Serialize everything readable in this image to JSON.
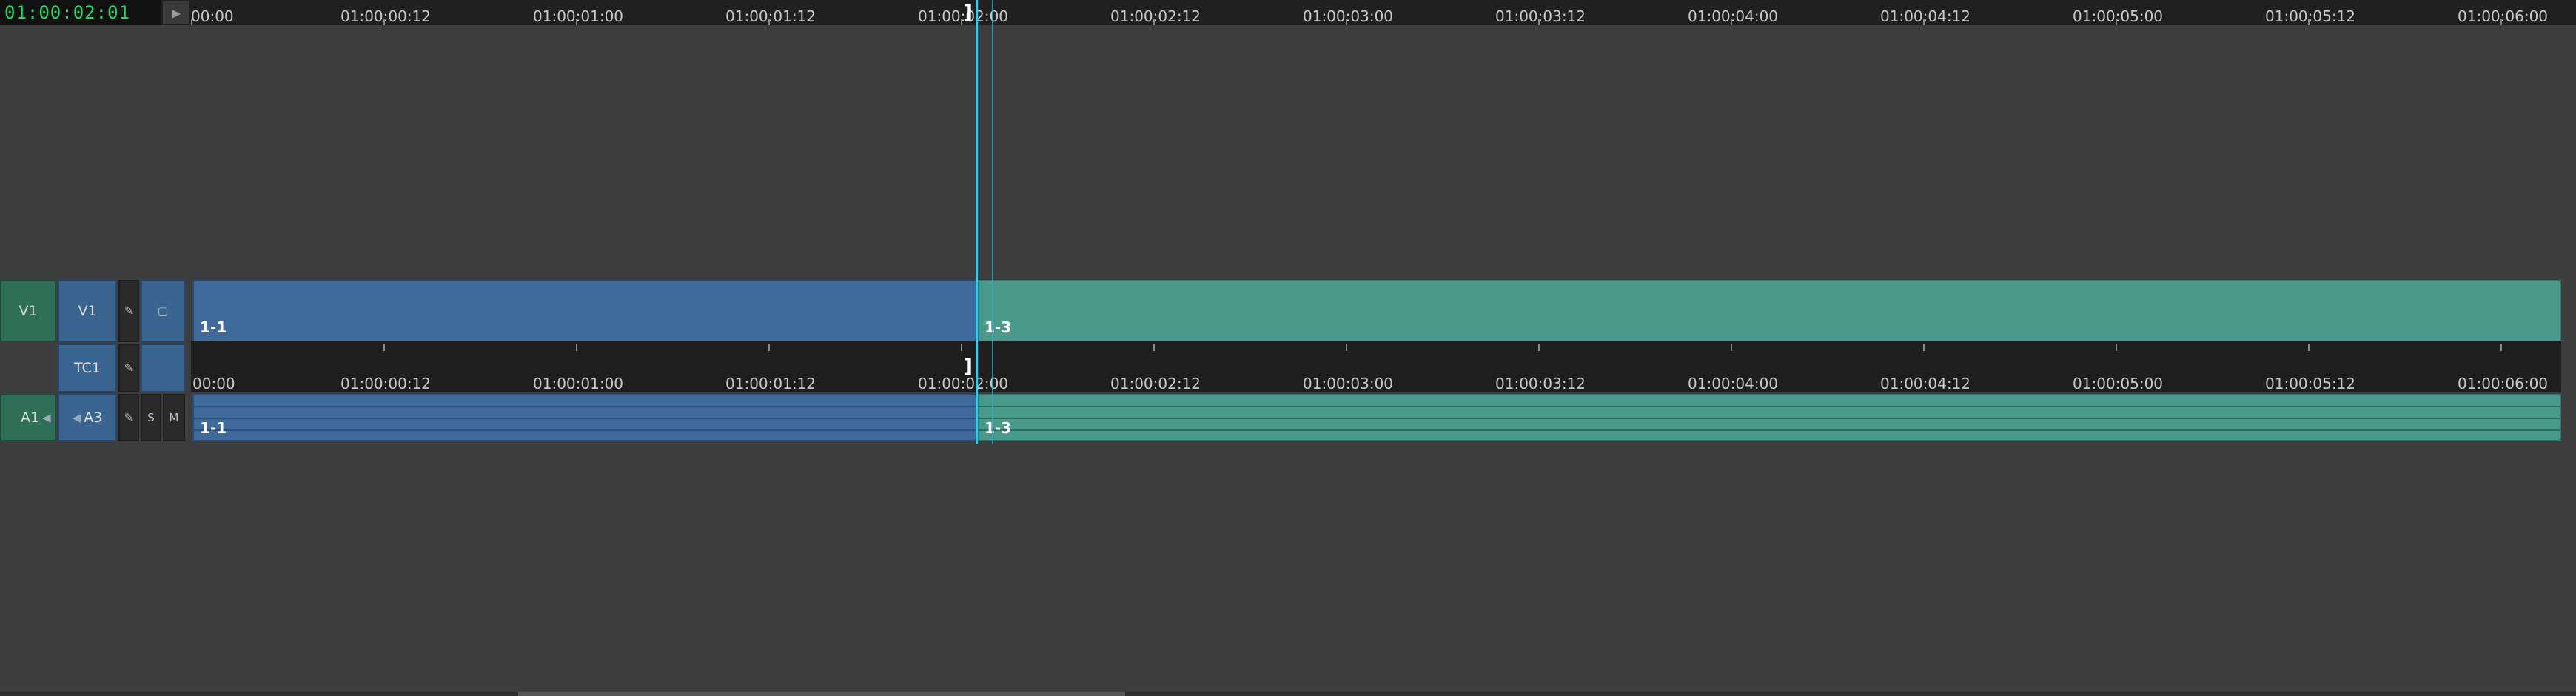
{
  "timecode": "01:00:02:01",
  "play_glyph": "▶",
  "ruler_labels": [
    "00:00",
    "01:00:00:12",
    "01:00:01:00",
    "01:00:01:12",
    "01:00:02:00",
    "01:00:02:12",
    "01:00:03:00",
    "01:00:03:12",
    "01:00:04:00",
    "01:00:04:12",
    "01:00:05:00",
    "01:00:05:12",
    "01:00:06:00"
  ],
  "tc_labels": [
    "00:00",
    "01:00:00:12",
    "01:00:01:00",
    "01:00:01:12",
    "01:00:02:00",
    "01:00:02:12",
    "01:00:03:00",
    "01:00:03:12",
    "01:00:04:00",
    "01:00:04:12",
    "01:00:05:00",
    "01:00:05:12",
    "01:00:06:00"
  ],
  "tracks": {
    "v1_source": "V1",
    "v1_record": "V1",
    "tc1": "TC1",
    "a1_source": "A1",
    "a3_record": "A3",
    "solo": "S",
    "mute": "M",
    "edit_glyph": "✎",
    "monitor_glyph": "▢",
    "speaker_glyph": "◀"
  },
  "clips": {
    "video_a": "1-1",
    "video_b": "1-3",
    "audio_a": "1-1",
    "audio_b": "1-3"
  },
  "playhead_bracket": "]",
  "colors": {
    "video_clip": "#3e6a9c",
    "teal_clip": "#4a9a8c",
    "playhead": "#41c6e6",
    "timecode": "#27d86a"
  }
}
